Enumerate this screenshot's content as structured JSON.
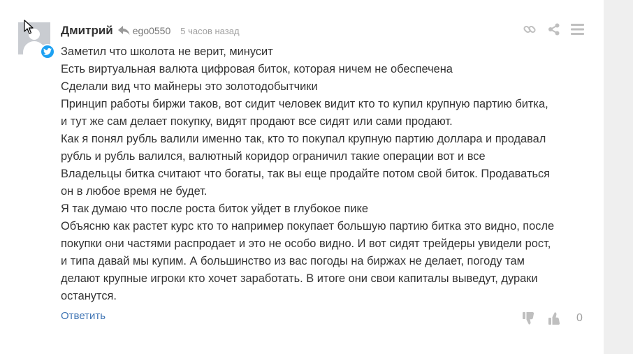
{
  "comment": {
    "author": "Дмитрий",
    "handle": "ego0550",
    "time": "5 часов назад",
    "lines": [
      "Заметил что школота не верит, минусит",
      "Есть виртуальная валюта цифровая биток, которая ничем не обеспечена",
      "Сделали вид что майнеры это золотодобытчики",
      "Принцип работы биржи таков, вот сидит человек видит кто то купил крупную партию битка,",
      "и тут же сам делает покупку, видят продают все сидят или сами продают.",
      "Как я понял рубль валили именно так, кто то покупал крупную партию доллара и продавал",
      "рубль и рубль валился, валютный коридор ограничил такие операции вот и все",
      "Владельцы битка считают что богаты, так вы еще продайте потом свой биток. Продаваться",
      "он в любое время не будет.",
      "Я так думаю что после роста биток уйдет в глубокое пике",
      "Объясню как растет курс кто то например покупает большую партию битка это видно, после",
      "покупки они частями распродает и это не особо видно. И вот сидят трейдеры увидели рост,",
      "и типа давай мы купим. А большинство из вас погоды на биржах не делает, погоду там",
      "делают крупные игроки кто хочет заработать. В итоге они свои капиталы выведут, дураки",
      "останутся."
    ],
    "reply_label": "Ответить",
    "vote_count": "0"
  },
  "icons": {
    "avatar": "user-avatar-placeholder",
    "badge": "twitter-icon",
    "reply": "reply-arrow-icon",
    "link": "link-icon",
    "share": "share-icon",
    "menu": "hamburger-menu-icon",
    "dislike": "thumbs-down-icon",
    "like": "thumbs-up-icon"
  },
  "colors": {
    "text": "#333333",
    "muted": "#a0a0a0",
    "link": "#3d73b3",
    "twitter": "#1da1f2",
    "icon": "#bfbfbf",
    "gutter": "#efefef"
  }
}
